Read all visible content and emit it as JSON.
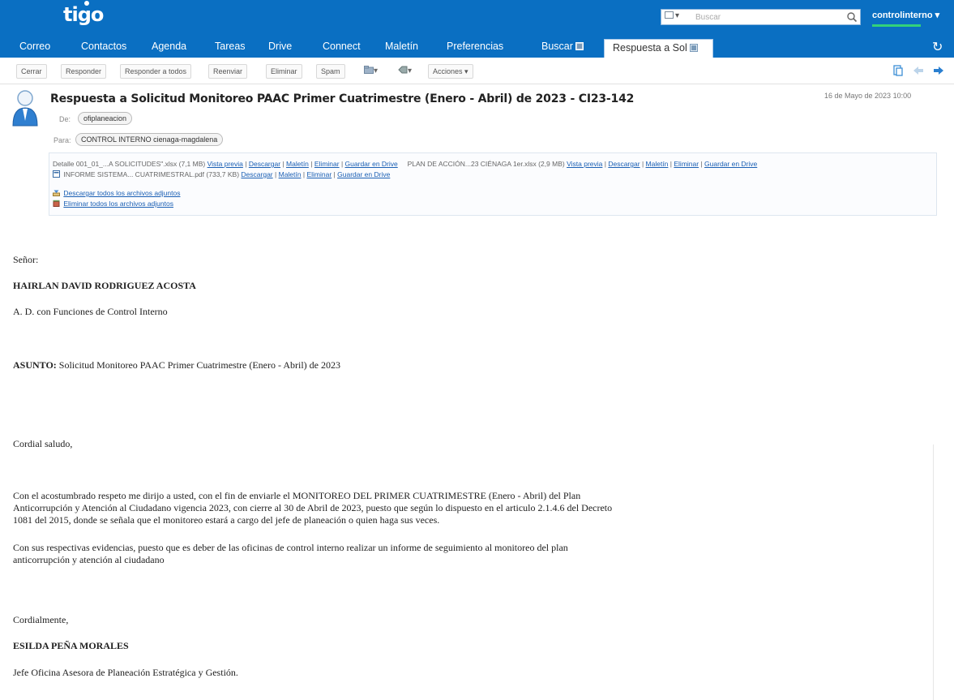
{
  "brand": {
    "logo": "tigo",
    "accent": "#0a6fc2",
    "status_green": "#33d17a"
  },
  "search": {
    "placeholder": "Buscar",
    "type_icon": "mail-icon"
  },
  "user": {
    "name": "controlinterno ▾"
  },
  "app_tabs": [
    "Correo",
    "Contactos",
    "Agenda",
    "Tareas",
    "Drive",
    "Connect",
    "Maletín",
    "Preferencias",
    "Buscar"
  ],
  "current_tab": "Respuesta a Sol",
  "toolbar": {
    "cerrar": "Cerrar",
    "responder": "Responder",
    "responder_todos": "Responder a todos",
    "reenviar": "Reenviar",
    "eliminar": "Eliminar",
    "spam": "Spam",
    "acciones": "Acciones ▾",
    "folder_caret": "▾",
    "tag_caret": "▾"
  },
  "message": {
    "subject": "Respuesta a Solicitud Monitoreo PAAC Primer Cuatrimestre (Enero - Abril) de 2023 - CI23-142",
    "date": "16 de Mayo de 2023 10:00",
    "from_label": "De:",
    "from": "ofiplaneacion",
    "to_label": "Para:",
    "to": "CONTROL INTERNO cienaga-magdalena"
  },
  "attachments": {
    "file1": "Detalle 001_01_...A SOLICITUDES\".xlsx",
    "file1_size": "(7,1 MB)",
    "file2": "PLAN DE ACCIÓN...23 CIÉNAGA 1er.xlsx",
    "file2_size": "(2,9 MB)",
    "file3": "INFORME SISTEMA... CUATRIMESTRAL.pdf",
    "file3_size": "(733,7 KB)",
    "vista_previa": "Vista previa",
    "descargar": "Descargar",
    "maletin": "Maletín",
    "eliminar": "Eliminar",
    "guardar_drive": "Guardar en Drive",
    "sep": "|",
    "download_all": "Descargar todos los archivos adjuntos",
    "delete_all": "Eliminar todos los archivos adjuntos"
  },
  "body": {
    "greeting": "Señor:",
    "recipient_name": "HAIRLAN DAVID RODRIGUEZ ACOSTA",
    "recipient_role": "A. D. con Funciones de Control Interno",
    "asunto_label": "ASUNTO:",
    "asunto_text": " Solicitud Monitoreo PAAC Primer Cuatrimestre (Enero - Abril) de 2023",
    "salutation": "Cordial saludo,",
    "p1_l1": "Con el acostumbrado respeto me dirijo a usted, con el fin de enviarle el MONITOREO DEL PRIMER CUATRIMESTRE (Enero - Abril) del Plan",
    "p1_l2": "Anticorrupción y Atención al Ciudadano vigencia 2023, con cierre al 30 de Abril de 2023, puesto que según lo dispuesto en el articulo 2.1.4.6 del Decreto",
    "p1_l3": "1081 del 2015, donde se señala que el monitoreo estará a cargo del jefe de planeación o quien haga sus veces.",
    "p2_l1": "Con sus respectivas evidencias, puesto que es deber de las oficinas de control interno realizar un informe de seguimiento al monitoreo del plan",
    "p2_l2": "anticorrupción y atención al ciudadano",
    "closing": "Cordialmente,",
    "sender_name": "ESILDA PEÑA MORALES",
    "sender_role": "Jefe Oficina Asesora de Planeación Estratégica y Gestión."
  }
}
